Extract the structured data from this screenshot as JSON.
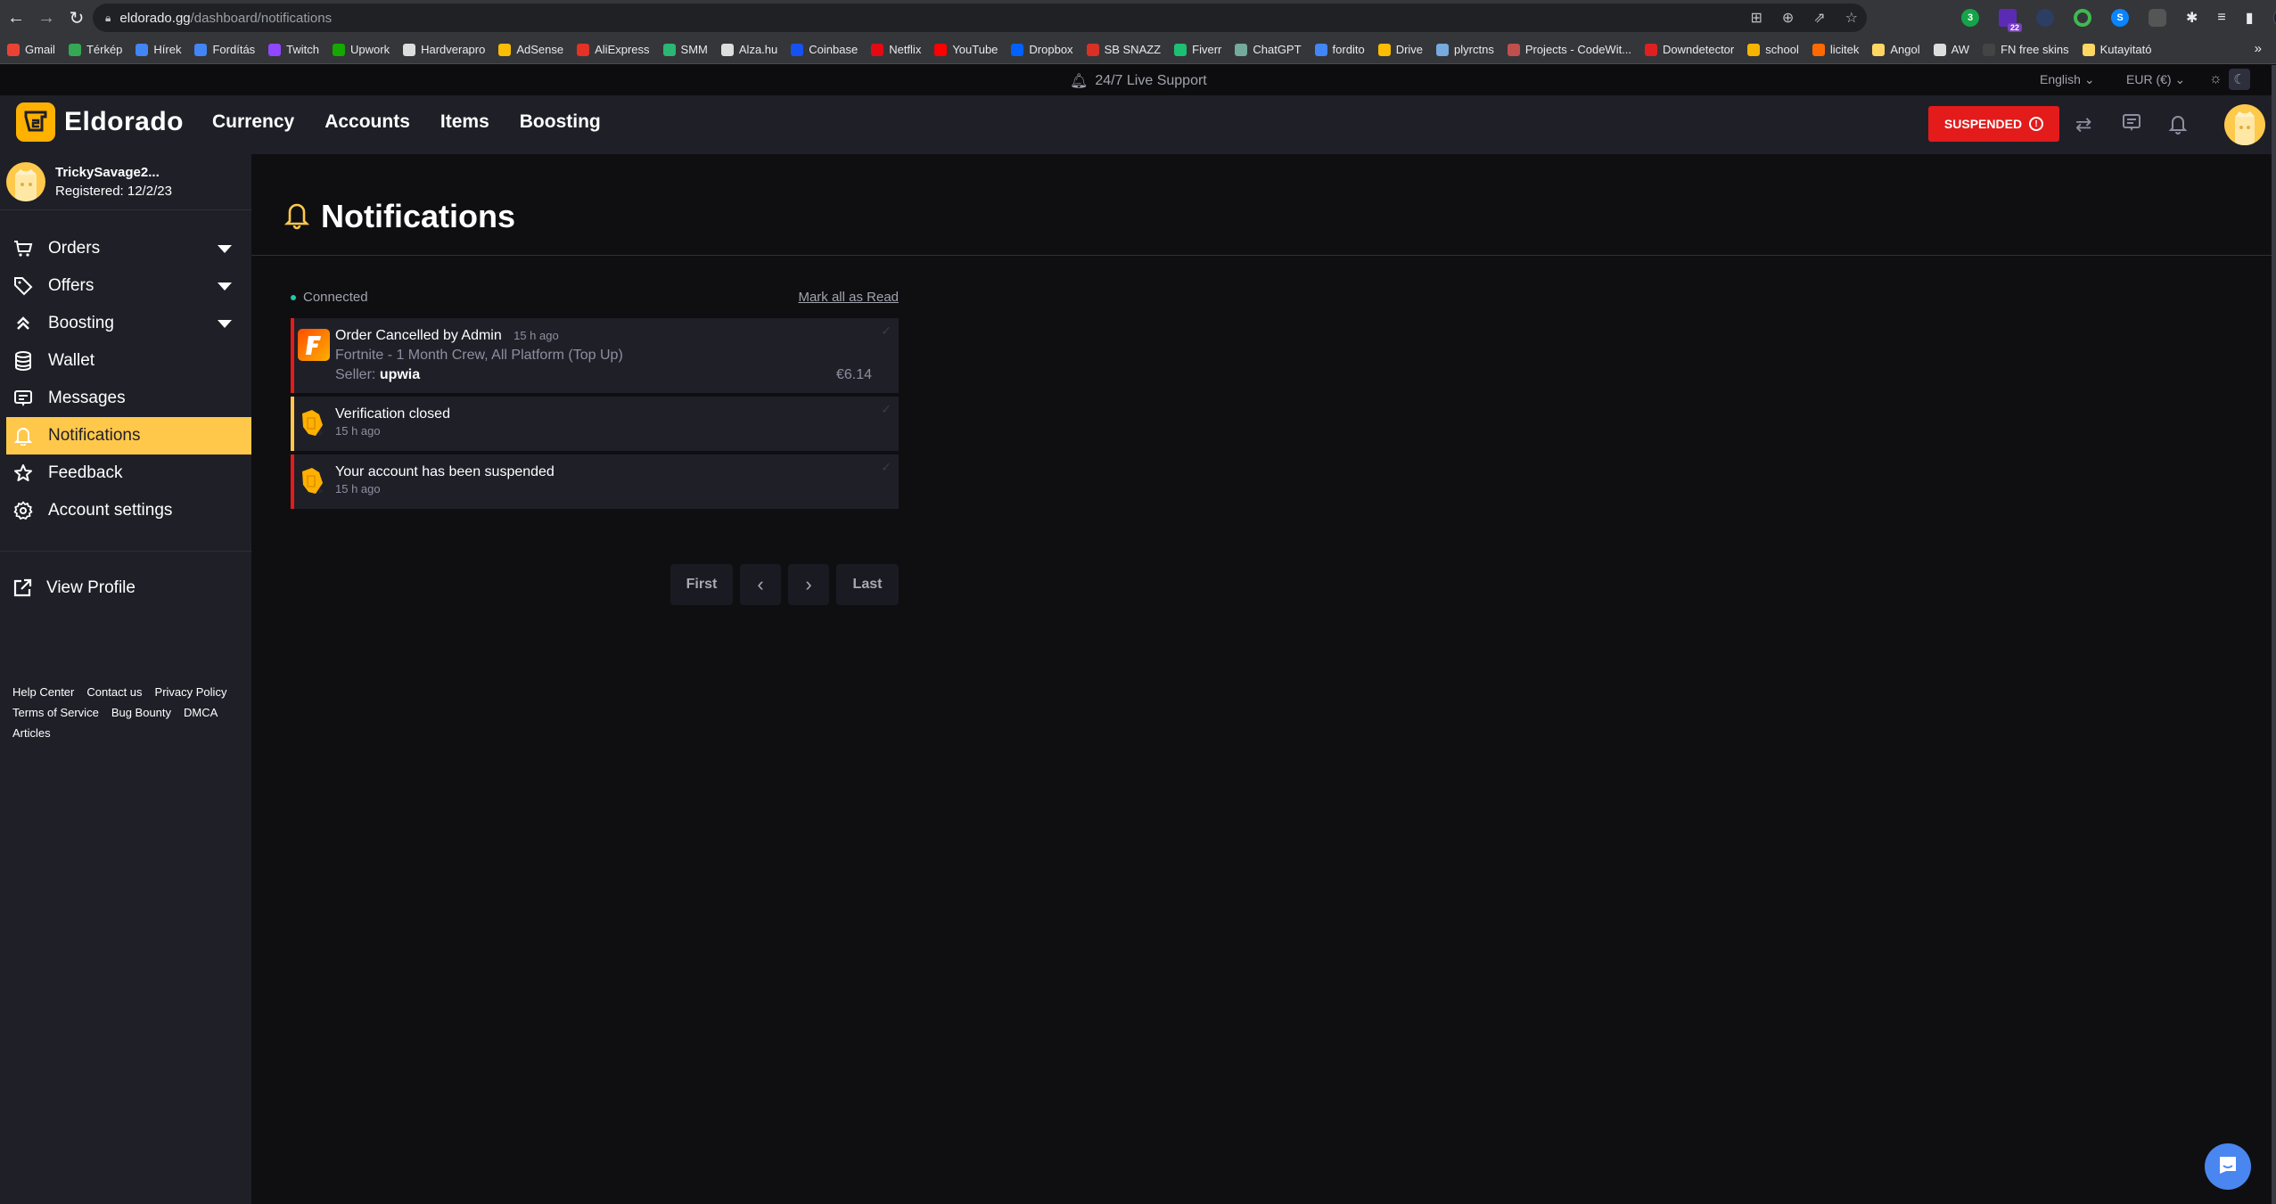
{
  "browser": {
    "url_host": "eldorado.gg",
    "url_path": "/dashboard/notifications",
    "extension_badge": "22",
    "bookmarks": [
      {
        "label": "Gmail",
        "color": "#ea4335"
      },
      {
        "label": "Térkép",
        "color": "#34a853"
      },
      {
        "label": "Hírek",
        "color": "#4285f4"
      },
      {
        "label": "Fordítás",
        "color": "#4285f4"
      },
      {
        "label": "Twitch",
        "color": "#9146ff"
      },
      {
        "label": "Upwork",
        "color": "#14a800"
      },
      {
        "label": "Hardverapro",
        "color": "#dddddd"
      },
      {
        "label": "AdSense",
        "color": "#fbbc04"
      },
      {
        "label": "AliExpress",
        "color": "#e43225"
      },
      {
        "label": "SMM",
        "color": "#2bb673"
      },
      {
        "label": "Alza.hu",
        "color": "#dddddd"
      },
      {
        "label": "Coinbase",
        "color": "#1652f0"
      },
      {
        "label": "Netflix",
        "color": "#e50914"
      },
      {
        "label": "YouTube",
        "color": "#ff0000"
      },
      {
        "label": "Dropbox",
        "color": "#0061ff"
      },
      {
        "label": "SB SNAZZ",
        "color": "#d93025"
      },
      {
        "label": "Fiverr",
        "color": "#1dbf73"
      },
      {
        "label": "ChatGPT",
        "color": "#74aa9c"
      },
      {
        "label": "fordito",
        "color": "#4285f4"
      },
      {
        "label": "Drive",
        "color": "#fbbc04"
      },
      {
        "label": "plyrctns",
        "color": "#7ad"
      },
      {
        "label": "Projects - CodeWit...",
        "color": "#c0504d"
      },
      {
        "label": "Downdetector",
        "color": "#e02020"
      },
      {
        "label": "school",
        "color": "#f4b400"
      },
      {
        "label": "licitek",
        "color": "#ff6a00"
      },
      {
        "label": "Angol",
        "color": "#fdd663"
      },
      {
        "label": "AW",
        "color": "#dddddd"
      },
      {
        "label": "FN free skins",
        "color": "#444444"
      },
      {
        "label": "Kutayitató",
        "color": "#fdd663"
      }
    ],
    "more_label": "»"
  },
  "support_strip": {
    "support_label": "24/7 Live Support",
    "language": "English",
    "currency": "EUR (€)"
  },
  "header": {
    "brand": "Eldorado",
    "nav": [
      "Currency",
      "Accounts",
      "Items",
      "Boosting"
    ],
    "status_button": "SUSPENDED",
    "brand_color": "#ffb100",
    "danger_color": "#e31b1b"
  },
  "sidebar": {
    "user_name": "TrickySavage2...",
    "registered": "Registered: 12/2/23",
    "items": [
      {
        "label": "Orders",
        "icon": "cart-icon",
        "has_caret": true
      },
      {
        "label": "Offers",
        "icon": "tag-icon",
        "has_caret": true
      },
      {
        "label": "Boosting",
        "icon": "chevrons-up-icon",
        "has_caret": true
      },
      {
        "label": "Wallet",
        "icon": "database-icon",
        "has_caret": false
      },
      {
        "label": "Messages",
        "icon": "message-icon",
        "has_caret": false
      },
      {
        "label": "Notifications",
        "icon": "bell-icon",
        "has_caret": false,
        "active": true
      },
      {
        "label": "Feedback",
        "icon": "star-icon",
        "has_caret": false
      },
      {
        "label": "Account settings",
        "icon": "gear-icon",
        "has_caret": false
      }
    ],
    "view_profile": "View Profile",
    "footer_links": [
      "Help Center",
      "Contact us",
      "Privacy Policy",
      "Terms of Service",
      "Bug Bounty",
      "DMCA",
      "Articles"
    ]
  },
  "main": {
    "title": "Notifications",
    "connection_status": "Connected",
    "mark_all_read": "Mark all as Read",
    "notifications": [
      {
        "title": "Order Cancelled by Admin",
        "time": "15 h ago",
        "subtitle": "Fortnite - 1 Month Crew, All Platform (Top Up)",
        "seller_label": "Seller:",
        "seller": "upwia",
        "price": "€6.14",
        "accent": "red",
        "icon": "fortnite-icon"
      },
      {
        "title": "Verification closed",
        "time": "15 h ago",
        "accent": "yellow",
        "icon": "shield-icon"
      },
      {
        "title": "Your account has been suspended",
        "time": "15 h ago",
        "accent": "red",
        "icon": "shield-icon"
      }
    ],
    "pagination": {
      "first": "First",
      "prev": "‹",
      "next": "›",
      "last": "Last"
    }
  }
}
